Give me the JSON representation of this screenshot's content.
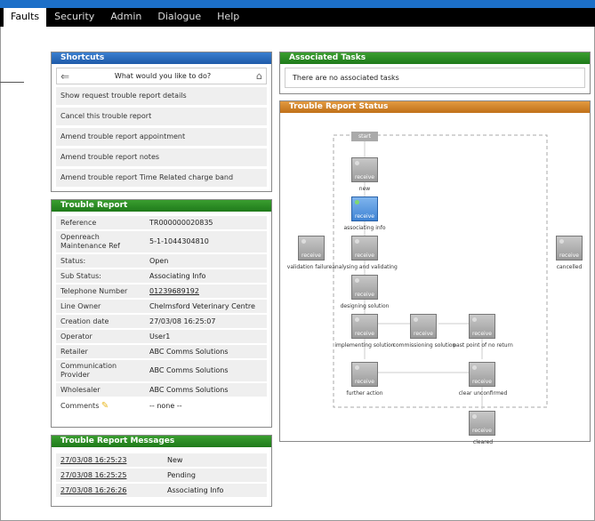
{
  "nav": {
    "tabs": [
      "Faults",
      "Security",
      "Admin",
      "Dialogue",
      "Help"
    ]
  },
  "shortcuts": {
    "title": "Shortcuts",
    "prompt": "What would you like to do?",
    "items": [
      "Show request trouble report details",
      "Cancel this trouble report",
      "Amend trouble report appointment",
      "Amend trouble report notes",
      "Amend trouble report Time Related charge band"
    ]
  },
  "trouble_report": {
    "title": "Trouble Report",
    "rows": [
      {
        "k": "Reference",
        "v": "TR000000020835"
      },
      {
        "k": "Openreach Maintenance Ref",
        "v": "5-1-1044304810"
      },
      {
        "k": "Status:",
        "v": "Open"
      },
      {
        "k": "Sub Status:",
        "v": "Associating Info"
      },
      {
        "k": "Telephone Number",
        "v": "01239689192"
      },
      {
        "k": "Line Owner",
        "v": "Chelmsford Veterinary Centre"
      },
      {
        "k": "Creation date",
        "v": "27/03/08 16:25:07"
      },
      {
        "k": "Operator",
        "v": "User1"
      },
      {
        "k": "Retailer",
        "v": "ABC Comms Solutions"
      },
      {
        "k": "Communication Provider",
        "v": "ABC Comms Solutions"
      },
      {
        "k": "Wholesaler",
        "v": "ABC Comms Solutions"
      },
      {
        "k": "Comments",
        "v": "-- none --"
      }
    ]
  },
  "messages": {
    "title": "Trouble Report Messages",
    "rows": [
      {
        "d": "27/03/08 16:25:23",
        "m": "New"
      },
      {
        "d": "27/03/08 16:25:25",
        "m": "Pending"
      },
      {
        "d": "27/03/08 16:26:26",
        "m": "Associating Info"
      }
    ]
  },
  "associated": {
    "title": "Associated Tasks",
    "text": "There are no associated tasks"
  },
  "status": {
    "title": "Trouble Report Status",
    "start": "start",
    "node_text": "receive",
    "labels": {
      "new": "new",
      "associating": "associating info",
      "analysing": "analysing and validating",
      "validation_failure": "validation failure",
      "cancelled": "cancelled",
      "designing": "designing solution",
      "implementing": "implementing solution",
      "commissioning": "commissioning solution",
      "past_point": "past point of no return",
      "further": "further action",
      "unconfirmed": "clear unconfirmed",
      "cleared": "cleared"
    }
  }
}
